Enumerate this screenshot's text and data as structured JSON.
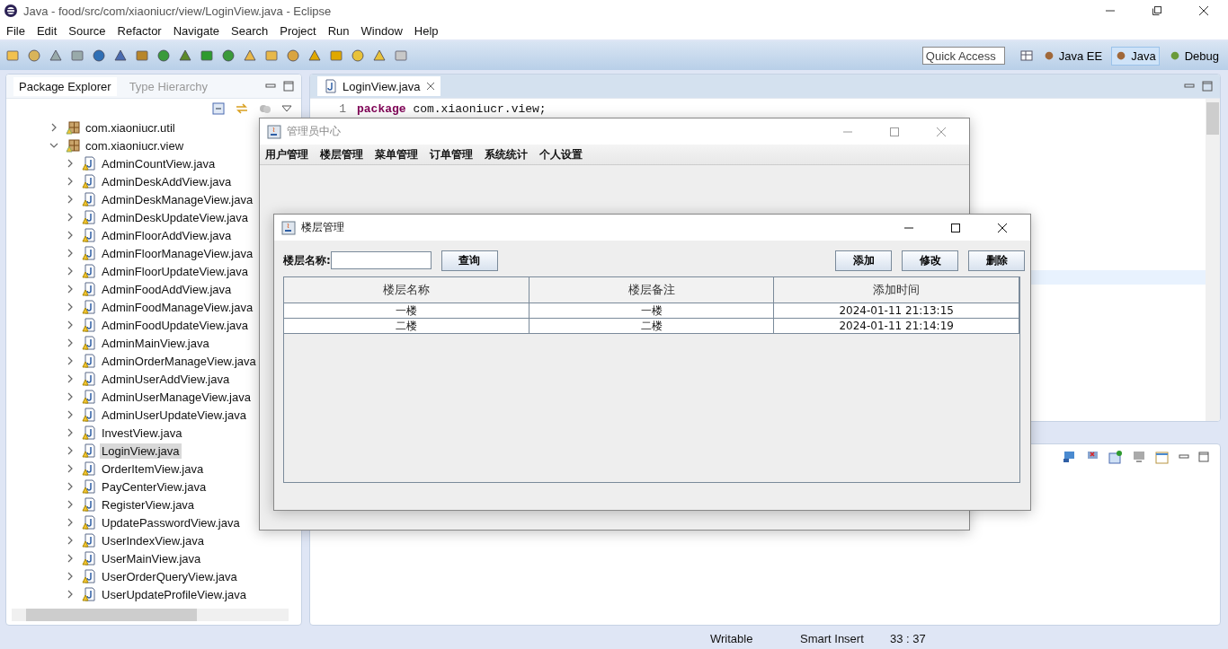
{
  "window": {
    "title": "Java - food/src/com/xiaoniucr/view/LoginView.java - Eclipse"
  },
  "menu_bar": [
    "File",
    "Edit",
    "Source",
    "Refactor",
    "Navigate",
    "Search",
    "Project",
    "Run",
    "Window",
    "Help"
  ],
  "quick_access": {
    "placeholder": "Quick Access"
  },
  "perspectives": [
    {
      "label": "Java EE",
      "selected": false
    },
    {
      "label": "Java",
      "selected": true
    },
    {
      "label": "Debug",
      "selected": false
    }
  ],
  "explorer_tabs": [
    {
      "label": "Package Explorer",
      "selected": true
    },
    {
      "label": "Type Hierarchy",
      "selected": false
    }
  ],
  "tree": [
    {
      "label": "com.xiaoniucr.util",
      "expanded": false
    },
    {
      "label": "com.xiaoniucr.view",
      "expanded": true,
      "children": [
        {
          "label": "AdminCountView.java",
          "selected": false
        },
        {
          "label": "AdminDeskAddView.java",
          "selected": false
        },
        {
          "label": "AdminDeskManageView.java",
          "selected": false
        },
        {
          "label": "AdminDeskUpdateView.java",
          "selected": false
        },
        {
          "label": "AdminFloorAddView.java",
          "selected": false
        },
        {
          "label": "AdminFloorManageView.java",
          "selected": false
        },
        {
          "label": "AdminFloorUpdateView.java",
          "selected": false
        },
        {
          "label": "AdminFoodAddView.java",
          "selected": false
        },
        {
          "label": "AdminFoodManageView.java",
          "selected": false
        },
        {
          "label": "AdminFoodUpdateView.java",
          "selected": false
        },
        {
          "label": "AdminMainView.java",
          "selected": false
        },
        {
          "label": "AdminOrderManageView.java",
          "selected": false
        },
        {
          "label": "AdminUserAddView.java",
          "selected": false
        },
        {
          "label": "AdminUserManageView.java",
          "selected": false
        },
        {
          "label": "AdminUserUpdateView.java",
          "selected": false
        },
        {
          "label": "InvestView.java",
          "selected": false
        },
        {
          "label": "LoginView.java",
          "selected": true
        },
        {
          "label": "OrderItemView.java",
          "selected": false
        },
        {
          "label": "PayCenterView.java",
          "selected": false
        },
        {
          "label": "RegisterView.java",
          "selected": false
        },
        {
          "label": "UpdatePasswordView.java",
          "selected": false
        },
        {
          "label": "UserIndexView.java",
          "selected": false
        },
        {
          "label": "UserMainView.java",
          "selected": false
        },
        {
          "label": "UserOrderQueryView.java",
          "selected": false
        },
        {
          "label": "UserUpdateProfileView.java",
          "selected": false
        }
      ]
    }
  ],
  "editor": {
    "tab": "LoginView.java",
    "lines": [
      {
        "number": "1",
        "keyword": "package",
        "text": "com.xiaoniucr.view;"
      }
    ]
  },
  "admin_window": {
    "title": "管理员中心",
    "menu": [
      "用户管理",
      "楼层管理",
      "菜单管理",
      "订单管理",
      "系统统计",
      "个人设置"
    ]
  },
  "floor_window": {
    "title": "楼层管理",
    "search_label": "楼层名称:",
    "query_button": "查询",
    "buttons": [
      "添加",
      "修改",
      "删除"
    ],
    "table": {
      "columns": [
        "楼层名称",
        "楼层备注",
        "添加时间"
      ],
      "rows": [
        [
          "一楼",
          "一楼",
          "2024-01-11 21:13:15"
        ],
        [
          "二楼",
          "二楼",
          "2024-01-11 21:14:19"
        ]
      ]
    }
  },
  "status_bar": [
    "Writable",
    "Smart Insert",
    "33 : 37"
  ]
}
